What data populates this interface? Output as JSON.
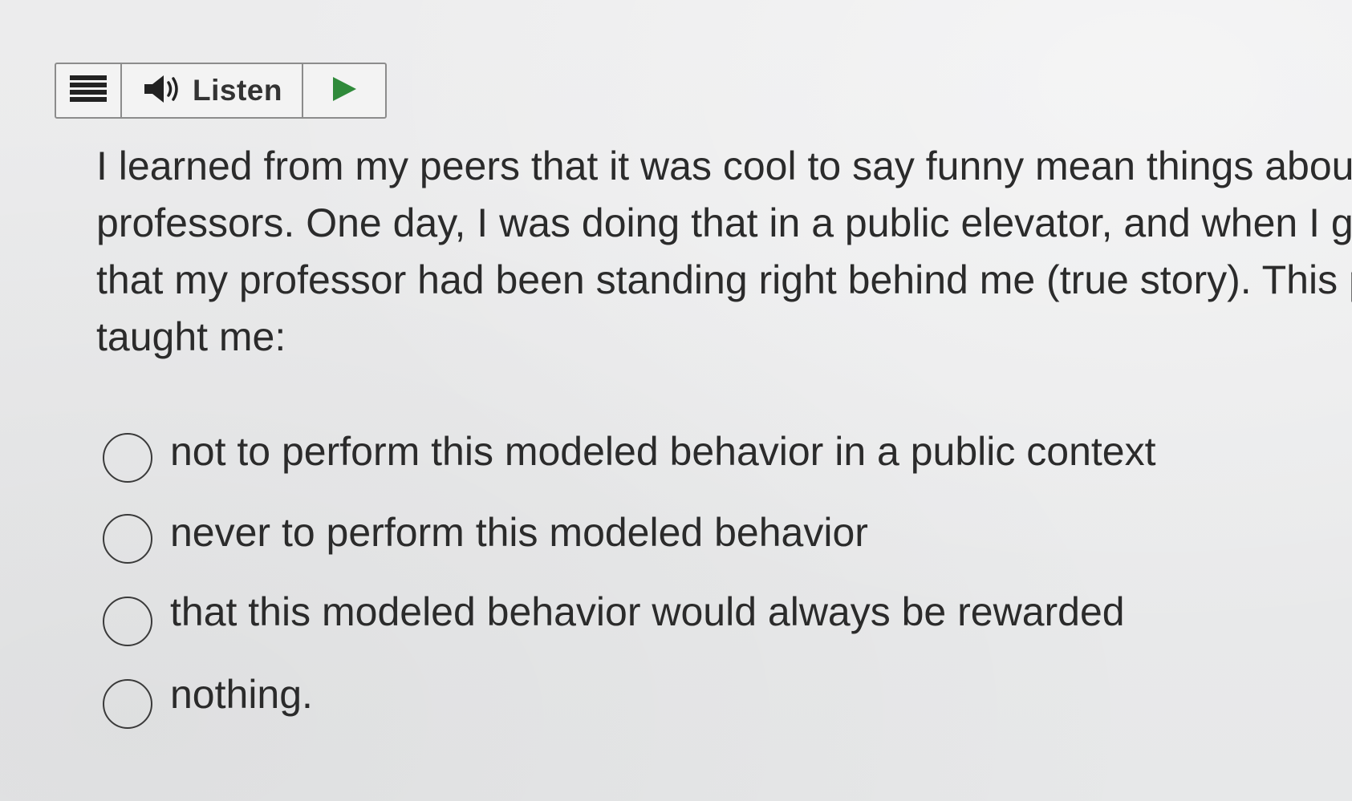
{
  "toolbar": {
    "menu_icon": "hamburger-menu-icon",
    "speaker_icon": "speaker-icon",
    "listen_label": "Listen",
    "play_icon": "play-icon",
    "play_color": "#2f8a3a"
  },
  "question": {
    "lines": [
      "I learned from my peers that it was cool to say funny mean things about",
      "professors. One day, I was doing that in a public elevator, and when I go",
      "that my professor had been standing right behind me (true story). This p",
      "taught me:"
    ]
  },
  "options": [
    {
      "label": "not to perform this modeled behavior in a public context",
      "selected": false
    },
    {
      "label": "never to perform this modeled behavior",
      "selected": false
    },
    {
      "label": "that this modeled behavior would always be rewarded",
      "selected": false
    },
    {
      "label": "nothing.",
      "selected": false
    }
  ]
}
